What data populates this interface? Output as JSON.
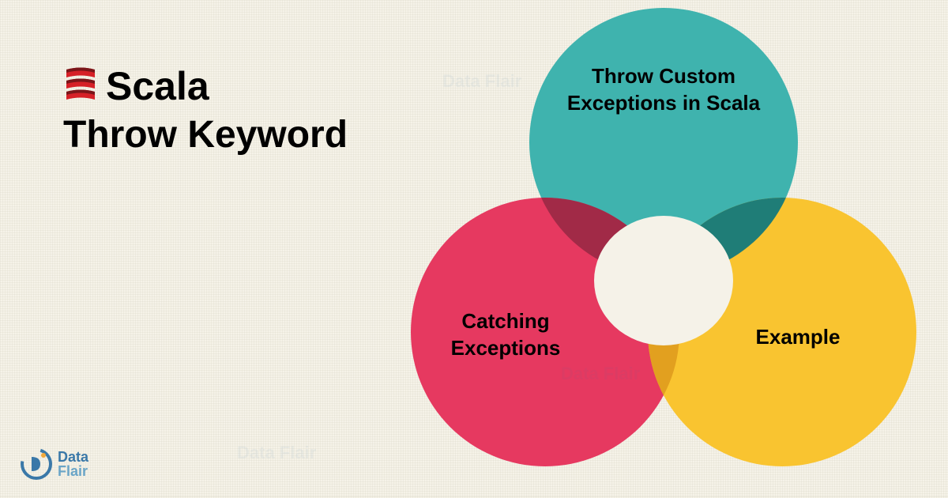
{
  "title": {
    "line1": "Scala",
    "line2": "Throw Keyword"
  },
  "venn": {
    "top_label": "Throw Custom Exceptions in Scala",
    "left_label": "Catching Exceptions",
    "right_label": "Example",
    "colors": {
      "top": "#3fb3ae",
      "left": "#e63960",
      "right": "#f9c430",
      "overlap_tl": "#a12a47",
      "overlap_tr": "#1f7d77",
      "overlap_bottom": "#e2a01f"
    }
  },
  "brand": {
    "name1": "Data",
    "name2": "Flair"
  },
  "watermark": "Data Flair"
}
